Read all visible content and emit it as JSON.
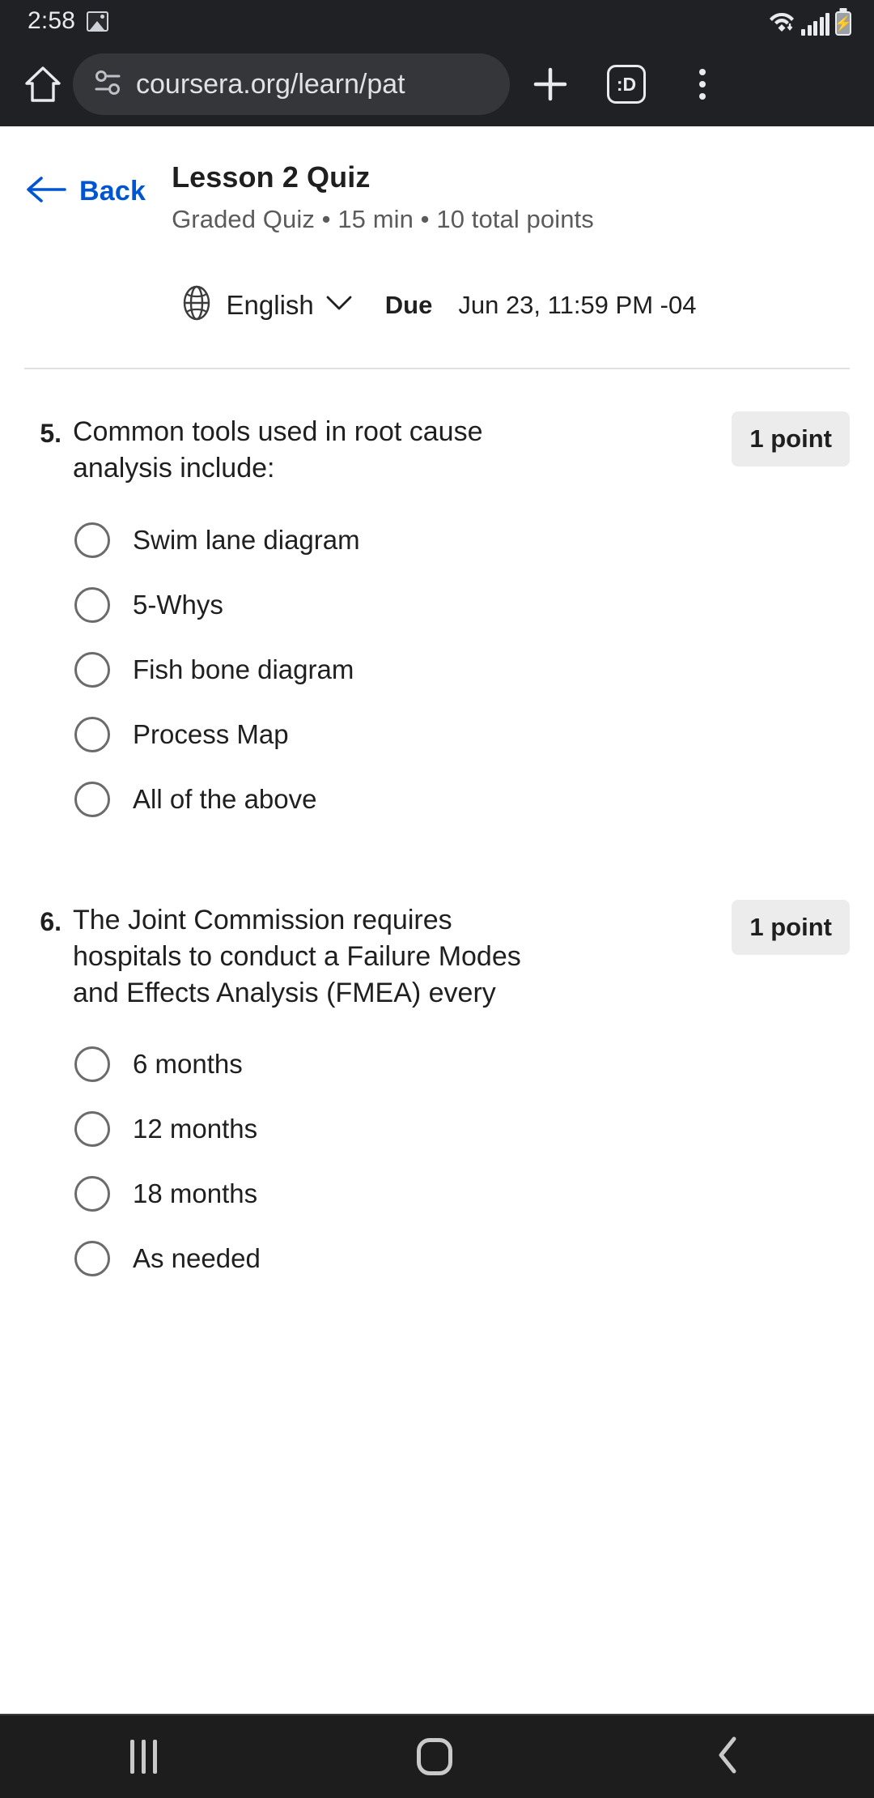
{
  "status_bar": {
    "time": "2:58",
    "icons": [
      "image-icon",
      "wifi-icon",
      "cellular-signal-icon",
      "battery-charging-icon"
    ]
  },
  "browser": {
    "home_icon": "home-icon",
    "permission_icon": "page-info-icon",
    "url": "coursera.org/learn/pat",
    "new_tab_icon": "plus-icon",
    "tab_count": ":D",
    "menu_icon": "overflow-menu-icon"
  },
  "header": {
    "back_label": "Back",
    "back_icon": "arrow-left-icon",
    "title": "Lesson 2 Quiz",
    "subtitle": "Graded Quiz • 15 min • 10 total points",
    "language_icon": "globe-icon",
    "language": "English",
    "language_chevron": "chevron-down-icon",
    "due_label": "Due",
    "due_value": "Jun 23, 11:59 PM -04"
  },
  "questions": [
    {
      "number": "5.",
      "text": "Common tools used in root cause analysis include:",
      "points": "1 point",
      "options": [
        "Swim lane diagram",
        "5-Whys",
        "Fish bone diagram",
        "Process Map",
        "All of the above"
      ]
    },
    {
      "number": "6.",
      "text": "The Joint Commission requires hospitals to conduct a Failure Modes and Effects Analysis (FMEA) every",
      "points": "1 point",
      "options": [
        "6 months",
        "12 months",
        "18 months",
        "As needed"
      ]
    }
  ],
  "nav_bar": {
    "recent_icon": "recent-apps-icon",
    "home_icon": "home-button-icon",
    "back_icon": "back-button-icon"
  },
  "colors": {
    "accent": "#0056d2",
    "chrome_bg": "#202124",
    "omnibox_bg": "#35363a",
    "points_badge_bg": "#ececec"
  }
}
